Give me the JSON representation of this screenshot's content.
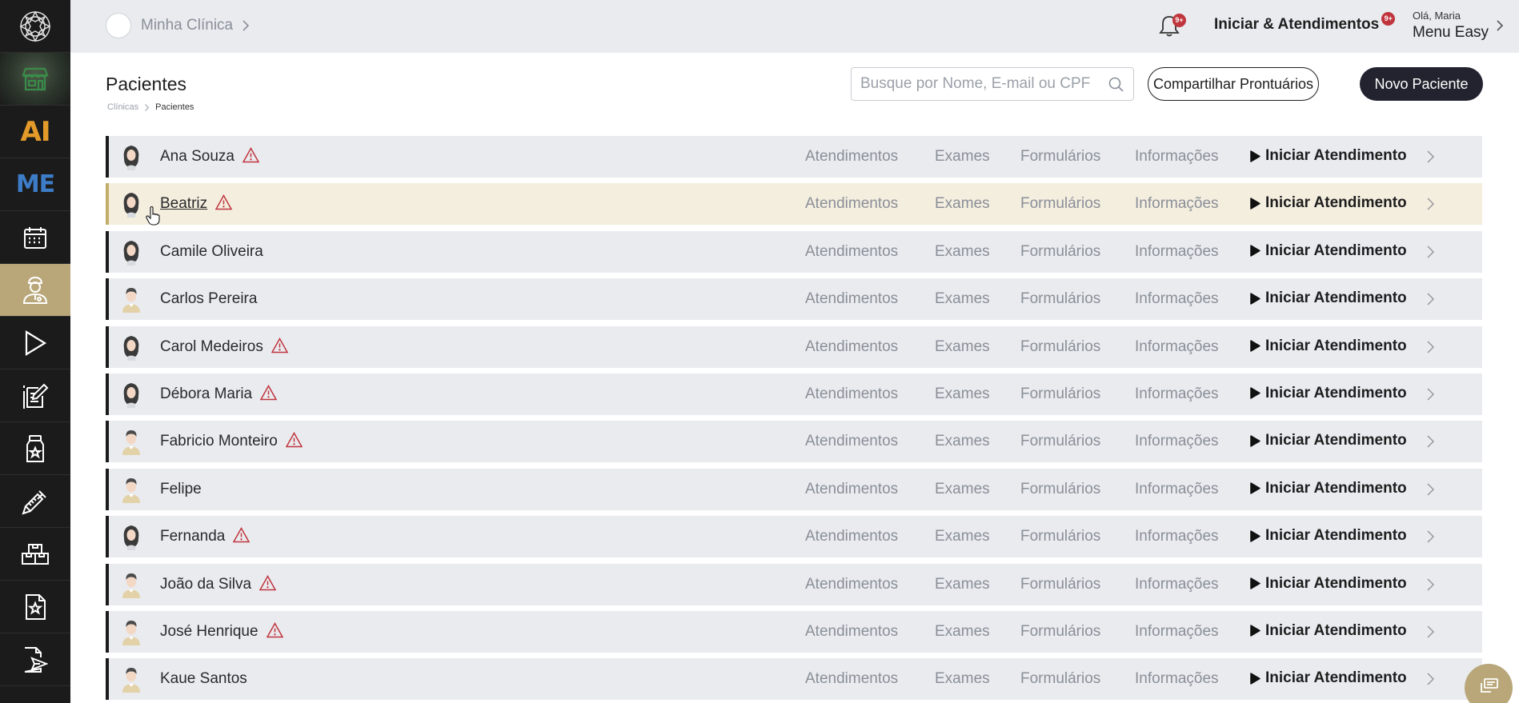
{
  "sidebar": {
    "items": [
      {
        "name": "logo",
        "icon": "logo-icon"
      },
      {
        "name": "store",
        "icon": "store-icon"
      },
      {
        "name": "ai",
        "label": "AI"
      },
      {
        "name": "menu-easy",
        "label": "ME"
      },
      {
        "name": "calendar",
        "icon": "calendar-icon"
      },
      {
        "name": "patients",
        "icon": "doctor-icon",
        "active": true
      },
      {
        "name": "play",
        "icon": "play-icon"
      },
      {
        "name": "notes",
        "icon": "edit-document-icon"
      },
      {
        "name": "medicine",
        "icon": "medicine-bottle-icon"
      },
      {
        "name": "syringe",
        "icon": "syringe-icon"
      },
      {
        "name": "inventory",
        "icon": "boxes-icon"
      },
      {
        "name": "favorites-doc",
        "icon": "star-document-icon"
      },
      {
        "name": "send-doc",
        "icon": "send-document-icon"
      }
    ]
  },
  "header": {
    "clinic_name": "Minha Clínica",
    "notifications_badge": "9+",
    "iniciar_label": "Iniciar & Atendimentos",
    "iniciar_badge": "9+",
    "greeting": "Olá, Maria",
    "user_menu": "Menu Easy"
  },
  "page": {
    "title": "Pacientes",
    "breadcrumb": [
      "Clínicas",
      "Pacientes"
    ],
    "search_placeholder": "Busque por Nome, E-mail ou CPF",
    "share_button": "Compartilhar Prontuários",
    "new_button": "Novo Paciente"
  },
  "row_actions": {
    "atendimentos": "Atendimentos",
    "exames": "Exames",
    "formularios": "Formulários",
    "informacoes": "Informações",
    "iniciar": "Iniciar Atendimento"
  },
  "patients": [
    {
      "name": "Ana Souza",
      "gender": "female",
      "warning": true
    },
    {
      "name": "Beatriz",
      "gender": "female",
      "warning": true,
      "hover": true
    },
    {
      "name": "Camile Oliveira",
      "gender": "female",
      "warning": false
    },
    {
      "name": "Carlos Pereira",
      "gender": "male",
      "warning": false
    },
    {
      "name": "Carol Medeiros",
      "gender": "female",
      "warning": true
    },
    {
      "name": "Débora Maria",
      "gender": "female",
      "warning": true
    },
    {
      "name": "Fabricio Monteiro",
      "gender": "male",
      "warning": true
    },
    {
      "name": "Felipe",
      "gender": "male",
      "warning": false
    },
    {
      "name": "Fernanda",
      "gender": "female",
      "warning": true
    },
    {
      "name": "João da Silva",
      "gender": "male",
      "warning": true
    },
    {
      "name": "José Henrique",
      "gender": "male",
      "warning": true
    },
    {
      "name": "Kaue Santos",
      "gender": "male",
      "warning": false
    }
  ],
  "colors": {
    "sidebar_bg": "#1b1b1b",
    "accent_gold": "#b9a77a",
    "header_bg": "#e9ebef",
    "row_bg": "#e9ebef",
    "row_hover_bg": "#f4eedf",
    "warning": "#c0353d",
    "primary_button": "#23232f"
  }
}
